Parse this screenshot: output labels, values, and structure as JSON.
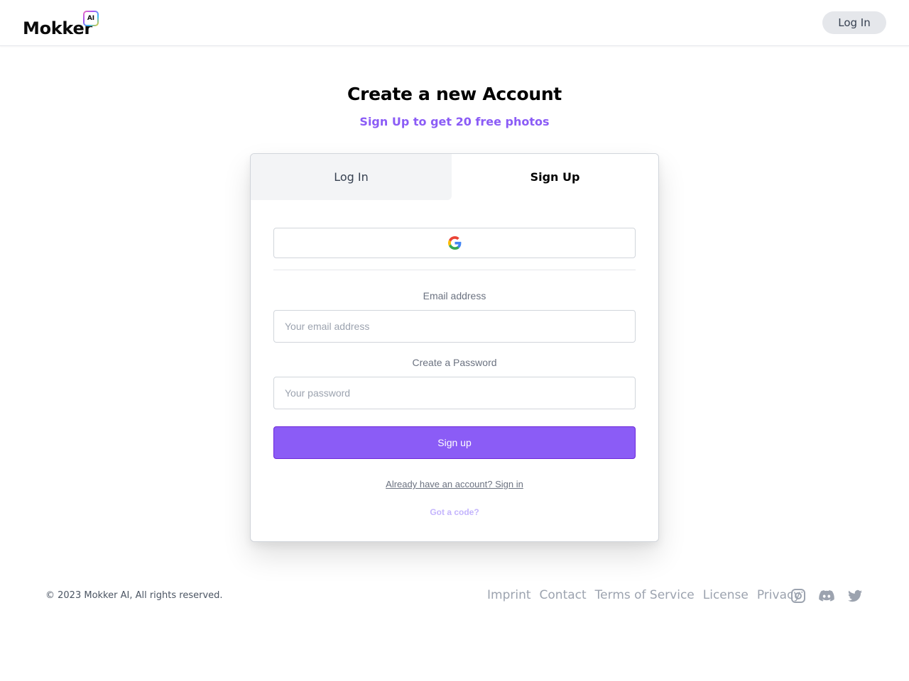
{
  "header": {
    "brand": "Mokker",
    "brand_badge": "AI",
    "login_button": "Log In"
  },
  "main": {
    "title": "Create a new Account",
    "subtitle": "Sign Up to get 20 free photos",
    "tabs": [
      {
        "label": "Log In",
        "active": false
      },
      {
        "label": "Sign Up",
        "active": true
      }
    ],
    "google_button": {
      "icon": "google-icon"
    },
    "email": {
      "label": "Email address",
      "placeholder": "Your email address",
      "value": ""
    },
    "password": {
      "label": "Create a Password",
      "placeholder": "Your password",
      "value": ""
    },
    "submit_label": "Sign up",
    "signin_link": "Already have an account? Sign in",
    "code_link": "Got a code?"
  },
  "footer": {
    "copyright": "© 2023 Mokker AI, All rights reserved.",
    "links": [
      "Imprint",
      "Contact",
      "Terms of Service",
      "License",
      "Privacy"
    ],
    "social": [
      "instagram-icon",
      "discord-icon",
      "twitter-icon"
    ]
  },
  "colors": {
    "accent": "#8b5cf6",
    "accent_light": "#c4b5fd",
    "muted_text": "#6b7280",
    "border": "#d1d5db"
  }
}
